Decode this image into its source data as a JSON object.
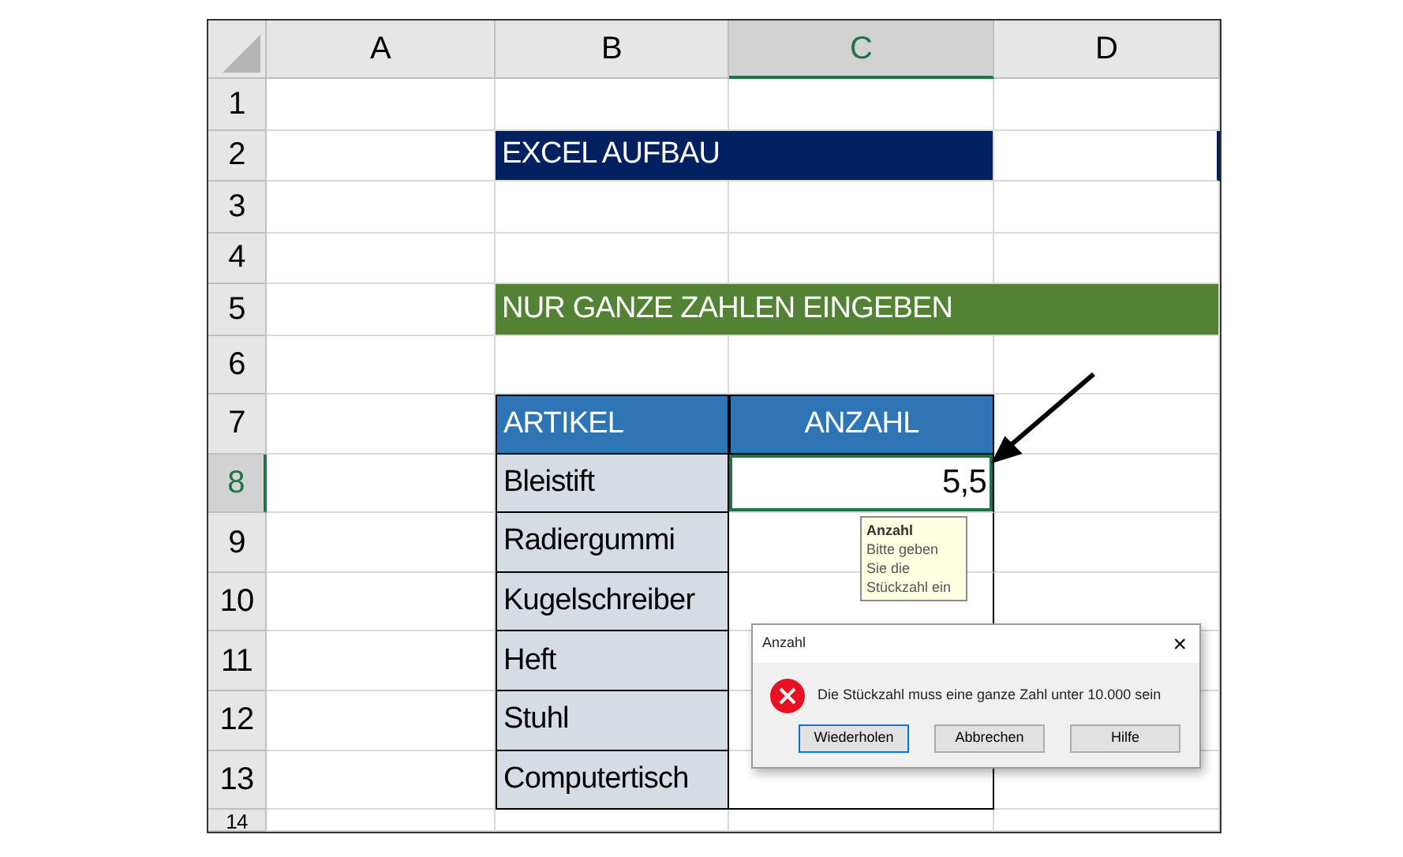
{
  "columns": [
    {
      "label": "A",
      "selected": false
    },
    {
      "label": "B",
      "selected": false
    },
    {
      "label": "C",
      "selected": true
    },
    {
      "label": "D",
      "selected": false
    }
  ],
  "rows": [
    {
      "number": "1",
      "selected": false,
      "cells": []
    },
    {
      "number": "2",
      "selected": false,
      "cells": [
        {
          "kind": "title",
          "text": "EXCEL AUFBAU"
        }
      ]
    },
    {
      "number": "3",
      "selected": false,
      "cells": []
    },
    {
      "number": "4",
      "selected": false,
      "cells": []
    },
    {
      "number": "5",
      "selected": false,
      "cells": [
        {
          "kind": "banner",
          "text": "NUR GANZE ZAHLEN EINGEBEN"
        }
      ]
    },
    {
      "number": "6",
      "selected": false,
      "cells": []
    },
    {
      "number": "7",
      "selected": false,
      "cells": [
        {
          "kind": "header",
          "text": "ARTIKEL"
        },
        {
          "kind": "header",
          "text": "ANZAHL"
        }
      ]
    },
    {
      "number": "8",
      "selected": true,
      "cells": [
        {
          "kind": "item",
          "text": "Bleistift"
        },
        {
          "kind": "value",
          "text": "5,5",
          "selected": true
        }
      ]
    },
    {
      "number": "9",
      "selected": false,
      "cells": [
        {
          "kind": "item",
          "text": "Radiergummi"
        },
        {
          "kind": "value",
          "selected": false
        }
      ]
    },
    {
      "number": "10",
      "selected": false,
      "cells": [
        {
          "kind": "item",
          "text": "Kugelschreiber"
        },
        {
          "kind": "value",
          "selected": false
        }
      ]
    },
    {
      "number": "11",
      "selected": false,
      "cells": [
        {
          "kind": "item",
          "text": "Heft"
        },
        {
          "kind": "value",
          "selected": false
        }
      ]
    },
    {
      "number": "12",
      "selected": false,
      "cells": [
        {
          "kind": "item",
          "text": "Stuhl"
        },
        {
          "kind": "value",
          "selected": false
        }
      ]
    },
    {
      "number": "13",
      "selected": false,
      "cells": [
        {
          "kind": "item",
          "text": "Computertisch"
        },
        {
          "kind": "value",
          "selected": false
        }
      ]
    },
    {
      "number": "14",
      "selected": false,
      "cells": []
    }
  ],
  "tooltip": {
    "title": "Anzahl",
    "text": "Bitte geben Sie die Stückzahl ein"
  },
  "dialog": {
    "title": "Anzahl",
    "close": "×",
    "message": "Die Stückzahl muss eine ganze Zahl unter 10.000 sein",
    "buttons": [
      {
        "label": "Wiederholen",
        "selected": true
      },
      {
        "label": "Abbrechen",
        "selected": false
      },
      {
        "label": "Hilfe",
        "selected": false
      }
    ]
  }
}
